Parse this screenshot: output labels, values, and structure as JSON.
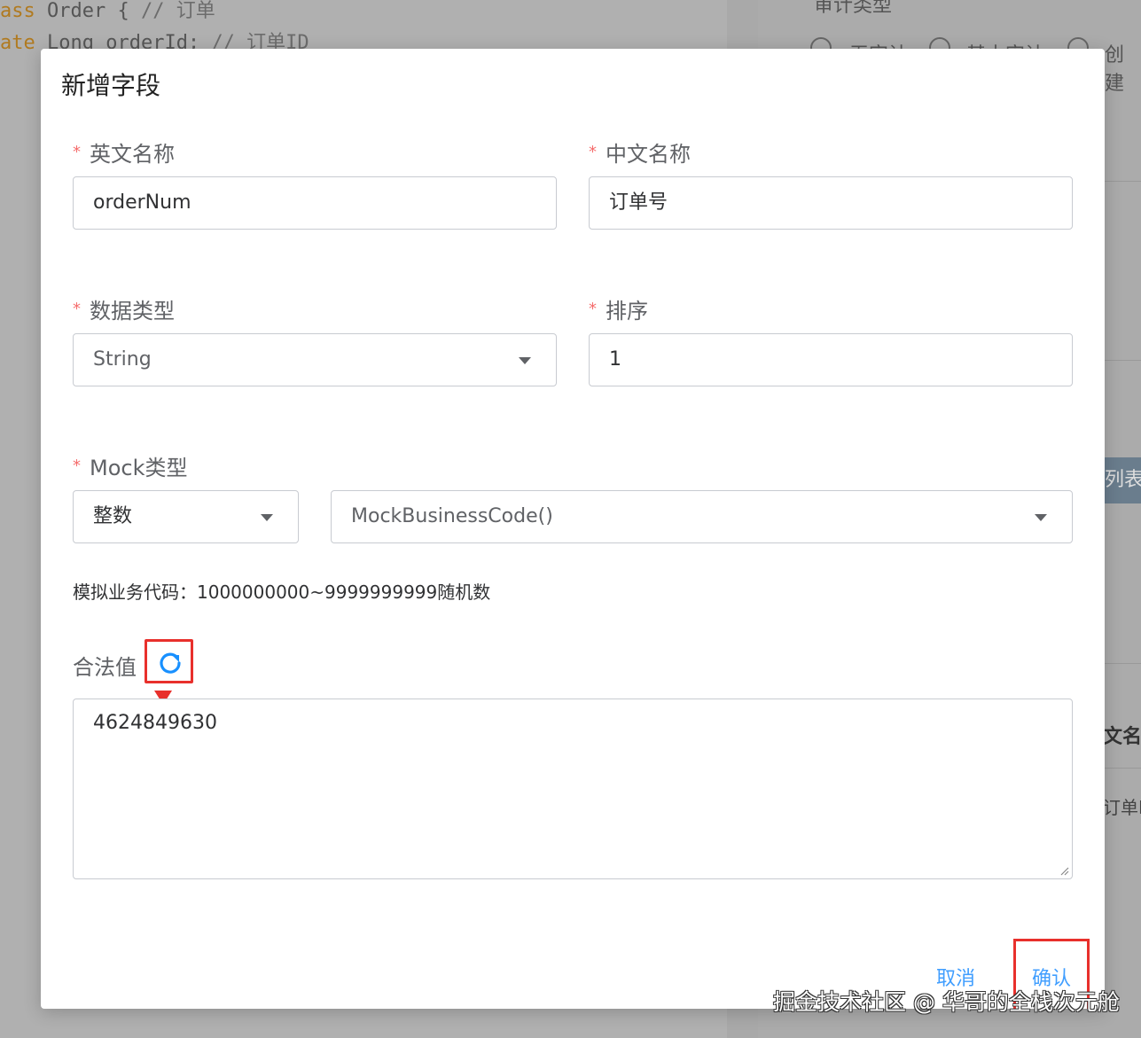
{
  "background": {
    "code_line1": {
      "kw": "ass",
      "text": " Order { ",
      "comment": "// 订单"
    },
    "code_line2": {
      "kw": "ate",
      "text": " Long orderId; ",
      "comment": "// 订单ID"
    },
    "audit_title": "审计类型",
    "radio_labels": [
      "无审计",
      "基本审计",
      "创建"
    ],
    "list_button": "列表",
    "column_header": "文名称",
    "cell_value": "订单ID"
  },
  "modal": {
    "title": "新增字段",
    "required_mark": "*",
    "english_name": {
      "label": "英文名称",
      "value": "orderNum"
    },
    "chinese_name": {
      "label": "中文名称",
      "value": "订单号"
    },
    "data_type": {
      "label": "数据类型",
      "value": "String"
    },
    "sort": {
      "label": "排序",
      "value": "1"
    },
    "mock_type": {
      "label": "Mock类型",
      "category": "整数",
      "function": "MockBusinessCode()"
    },
    "mock_hint": "模拟业务代码：1000000000~9999999999随机数",
    "legal_value": {
      "label": "合法值",
      "value": "4624849630"
    },
    "cancel_label": "取消",
    "confirm_label": "确认"
  },
  "watermark": "掘金技术社区 @ 华哥的全栈次元舱",
  "colors": {
    "required": "#f56c6c",
    "link": "#409eff",
    "highlight": "#e8302c"
  }
}
